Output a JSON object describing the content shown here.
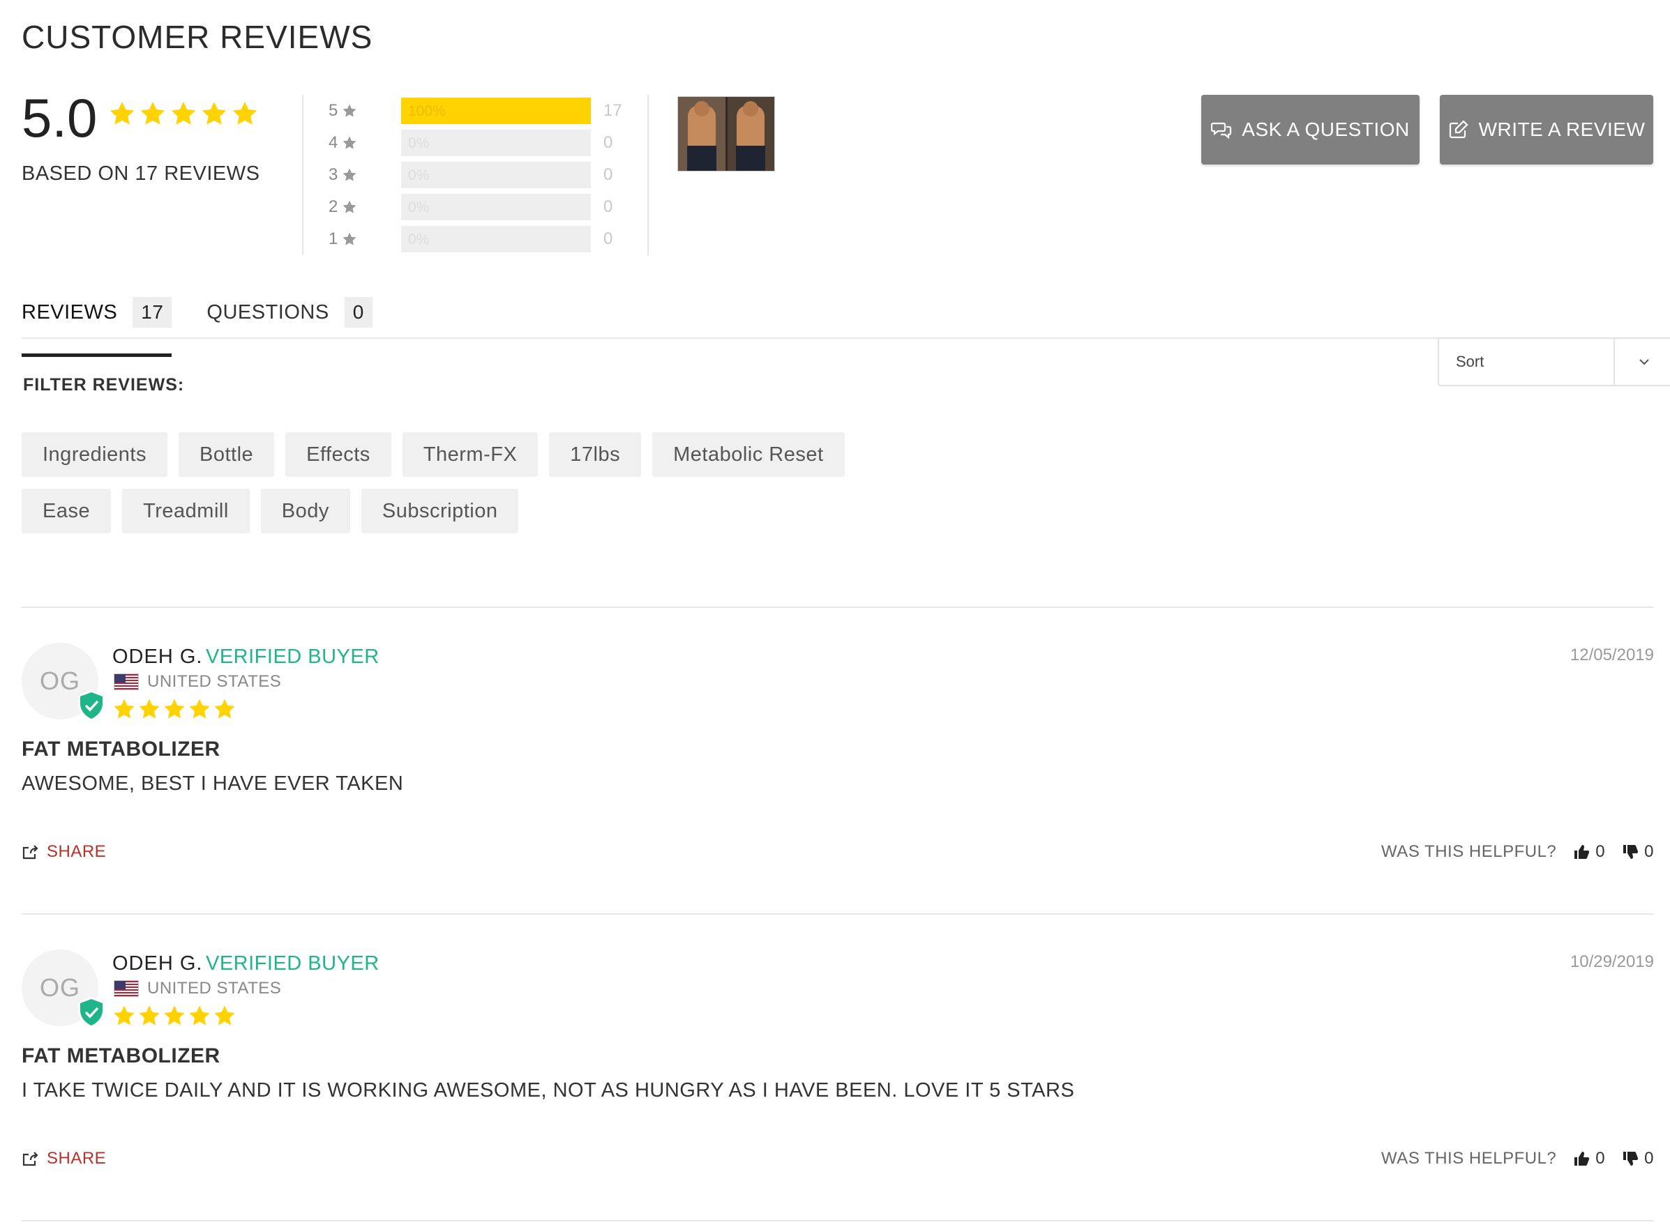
{
  "header": {
    "title": "CUSTOMER REVIEWS"
  },
  "summary": {
    "average": "5.0",
    "average_stars": 5,
    "based_on": "BASED ON 17 REVIEWS",
    "breakdown": [
      {
        "stars": "5",
        "percent": "100%",
        "fraction": 1.0,
        "count": "17"
      },
      {
        "stars": "4",
        "percent": "0%",
        "fraction": 0.0,
        "count": "0"
      },
      {
        "stars": "3",
        "percent": "0%",
        "fraction": 0.0,
        "count": "0"
      },
      {
        "stars": "2",
        "percent": "0%",
        "fraction": 0.0,
        "count": "0"
      },
      {
        "stars": "1",
        "percent": "0%",
        "fraction": 0.0,
        "count": "0"
      }
    ]
  },
  "actions": {
    "ask_label": "ASK A QUESTION",
    "write_label": "WRITE A REVIEW"
  },
  "tabs": [
    {
      "label": "REVIEWS",
      "count": "17"
    },
    {
      "label": "QUESTIONS",
      "count": "0"
    }
  ],
  "sort": {
    "label": "Sort"
  },
  "filters": {
    "label": "FILTER REVIEWS:",
    "rows": [
      [
        "Ingredients",
        "Bottle",
        "Effects",
        "Therm-FX",
        "17lbs",
        "Metabolic Reset"
      ],
      [
        "Ease",
        "Treadmill",
        "Body",
        "Subscription"
      ]
    ]
  },
  "reviews": [
    {
      "initials": "OG",
      "name": "ODEH G.",
      "verified": "VERIFIED BUYER",
      "country": "UNITED STATES",
      "rating": 5,
      "date": "12/05/2019",
      "title": "FAT METABOLIZER",
      "body": "AWESOME, BEST I HAVE EVER TAKEN",
      "share": "SHARE",
      "helpful": "WAS THIS HELPFUL?",
      "up": "0",
      "down": "0"
    },
    {
      "initials": "OG",
      "name": "ODEH G.",
      "verified": "VERIFIED BUYER",
      "country": "UNITED STATES",
      "rating": 5,
      "date": "10/29/2019",
      "title": "FAT METABOLIZER",
      "body": "I TAKE TWICE DAILY AND IT IS WORKING AWESOME, NOT AS HUNGRY AS I HAVE BEEN. LOVE IT 5 STARS",
      "share": "SHARE",
      "helpful": "WAS THIS HELPFUL?",
      "up": "0",
      "down": "0"
    }
  ],
  "colors": {
    "star": "#ffd200",
    "button": "#808080",
    "verified": "#1fb58a",
    "share": "#b8322a"
  }
}
